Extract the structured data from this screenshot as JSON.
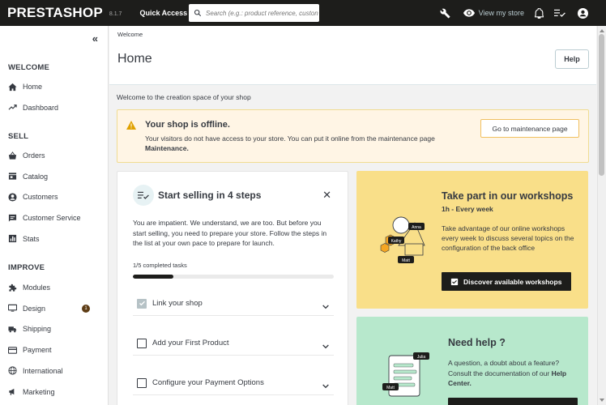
{
  "header": {
    "logo": "PRESTASHOP",
    "version": "8.1.7",
    "quick_access": "Quick Access",
    "search_placeholder": "Search (e.g.: product reference, custon",
    "view_store": "View my store"
  },
  "sidebar": {
    "sections": [
      {
        "title": "WELCOME",
        "items": [
          {
            "label": "Home",
            "icon": "home-icon",
            "active": true
          },
          {
            "label": "Dashboard",
            "icon": "trending-up-icon"
          }
        ]
      },
      {
        "title": "SELL",
        "items": [
          {
            "label": "Orders",
            "icon": "basket-icon"
          },
          {
            "label": "Catalog",
            "icon": "store-icon"
          },
          {
            "label": "Customers",
            "icon": "account-circle-icon"
          },
          {
            "label": "Customer Service",
            "icon": "chat-icon"
          },
          {
            "label": "Stats",
            "icon": "bar-chart-icon"
          }
        ]
      },
      {
        "title": "IMPROVE",
        "items": [
          {
            "label": "Modules",
            "icon": "puzzle-icon"
          },
          {
            "label": "Design",
            "icon": "desktop-icon",
            "badge": "1"
          },
          {
            "label": "Shipping",
            "icon": "truck-icon"
          },
          {
            "label": "Payment",
            "icon": "credit-card-icon"
          },
          {
            "label": "International",
            "icon": "globe-icon"
          },
          {
            "label": "Marketing",
            "icon": "megaphone-icon"
          }
        ]
      }
    ]
  },
  "page": {
    "breadcrumb": "Welcome",
    "title": "Home",
    "help": "Help",
    "welcome_text": "Welcome to the creation space of your shop"
  },
  "alert": {
    "title": "Your shop is offline.",
    "text": "Your visitors do not have access to your store. You can put it online from the maintenance page",
    "text_bold": "Maintenance.",
    "button": "Go to maintenance page"
  },
  "steps": {
    "title": "Start selling in 4 steps",
    "close": "✕",
    "description": "You are impatient. We understand, we are too. But before you start selling, you need to prepare your store. Follow the steps in the list at your own pace to prepare for launch.",
    "progress_label": "1/5 completed tasks",
    "progress_fraction": 0.2,
    "tasks": [
      {
        "label": "Link your shop",
        "done": true
      },
      {
        "label": "Add your First Product",
        "done": false
      },
      {
        "label": "Configure your Payment Options",
        "done": false
      }
    ]
  },
  "workshop": {
    "title": "Take part in our workshops",
    "subtitle": "1h - Every week",
    "description": "Take advantage of our online workshops every week to discuss several topics on the configuration of the back office",
    "button": "Discover available workshops",
    "illustration_names": [
      "Anna",
      "Kathy",
      "Matt"
    ]
  },
  "help_card": {
    "title": "Need help ?",
    "description": "A question, a doubt about a feature? Consult the documentation of our",
    "description_bold": "Help Center.",
    "illustration_names": [
      "Julia",
      "Matt"
    ]
  },
  "colors": {
    "topbar": "#1d1d1b",
    "alert_bg": "#fff5e5",
    "workshop_bg": "#f9df89",
    "help_bg": "#b7e8cc",
    "warning": "#e0a100"
  }
}
